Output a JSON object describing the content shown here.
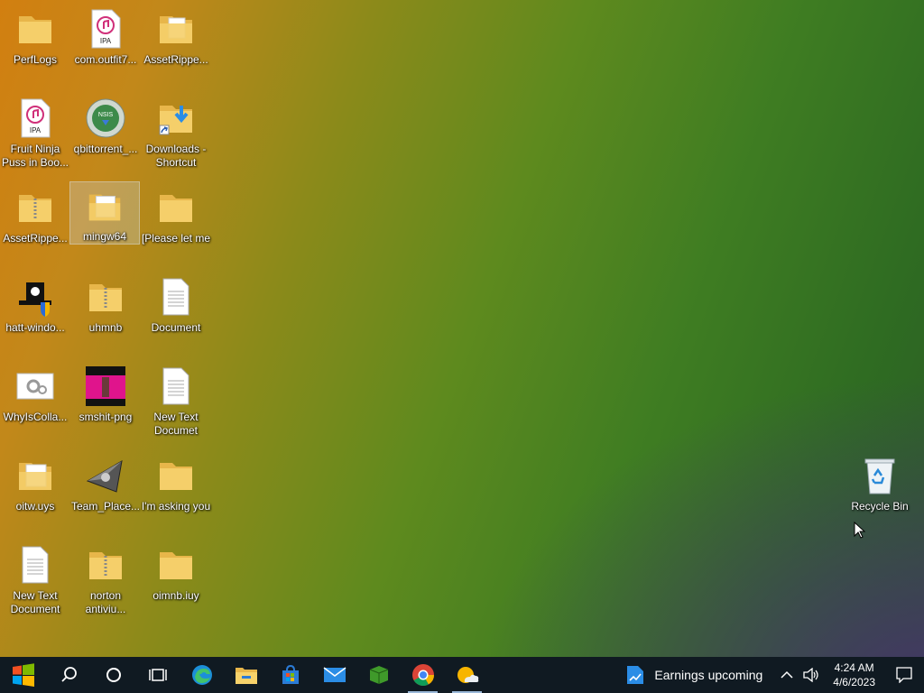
{
  "desktop": {
    "icons": [
      {
        "label": "PerfLogs"
      },
      {
        "label": "com.outfit7...",
        "badge": "IPA"
      },
      {
        "label": "AssetRippe..."
      },
      {
        "label": "Fruit Ninja Puss in Boo...",
        "badge": "IPA"
      },
      {
        "label": "qbittorrent_...",
        "badge": "NSIS"
      },
      {
        "label": "Downloads - Shortcut"
      },
      {
        "label": "AssetRippe..."
      },
      {
        "label": "mingw64"
      },
      {
        "label": "[Please let me"
      },
      {
        "label": "hatt-windo..."
      },
      {
        "label": "uhmnb"
      },
      {
        "label": "Document"
      },
      {
        "label": "WhyIsColla..."
      },
      {
        "label": "smshit-png"
      },
      {
        "label": "New Text Documet"
      },
      {
        "label": "oitw.uys"
      },
      {
        "label": "Team_Place..."
      },
      {
        "label": "I'm  asking you"
      },
      {
        "label": "New Text Document"
      },
      {
        "label": "norton antiviu..."
      },
      {
        "label": "oimnb.iuy"
      },
      {
        "label": "Recycle Bin"
      }
    ]
  },
  "taskbar": {
    "news_text": "Earnings upcoming",
    "clock_time": "4:24 AM",
    "clock_date": "4/6/2023"
  }
}
